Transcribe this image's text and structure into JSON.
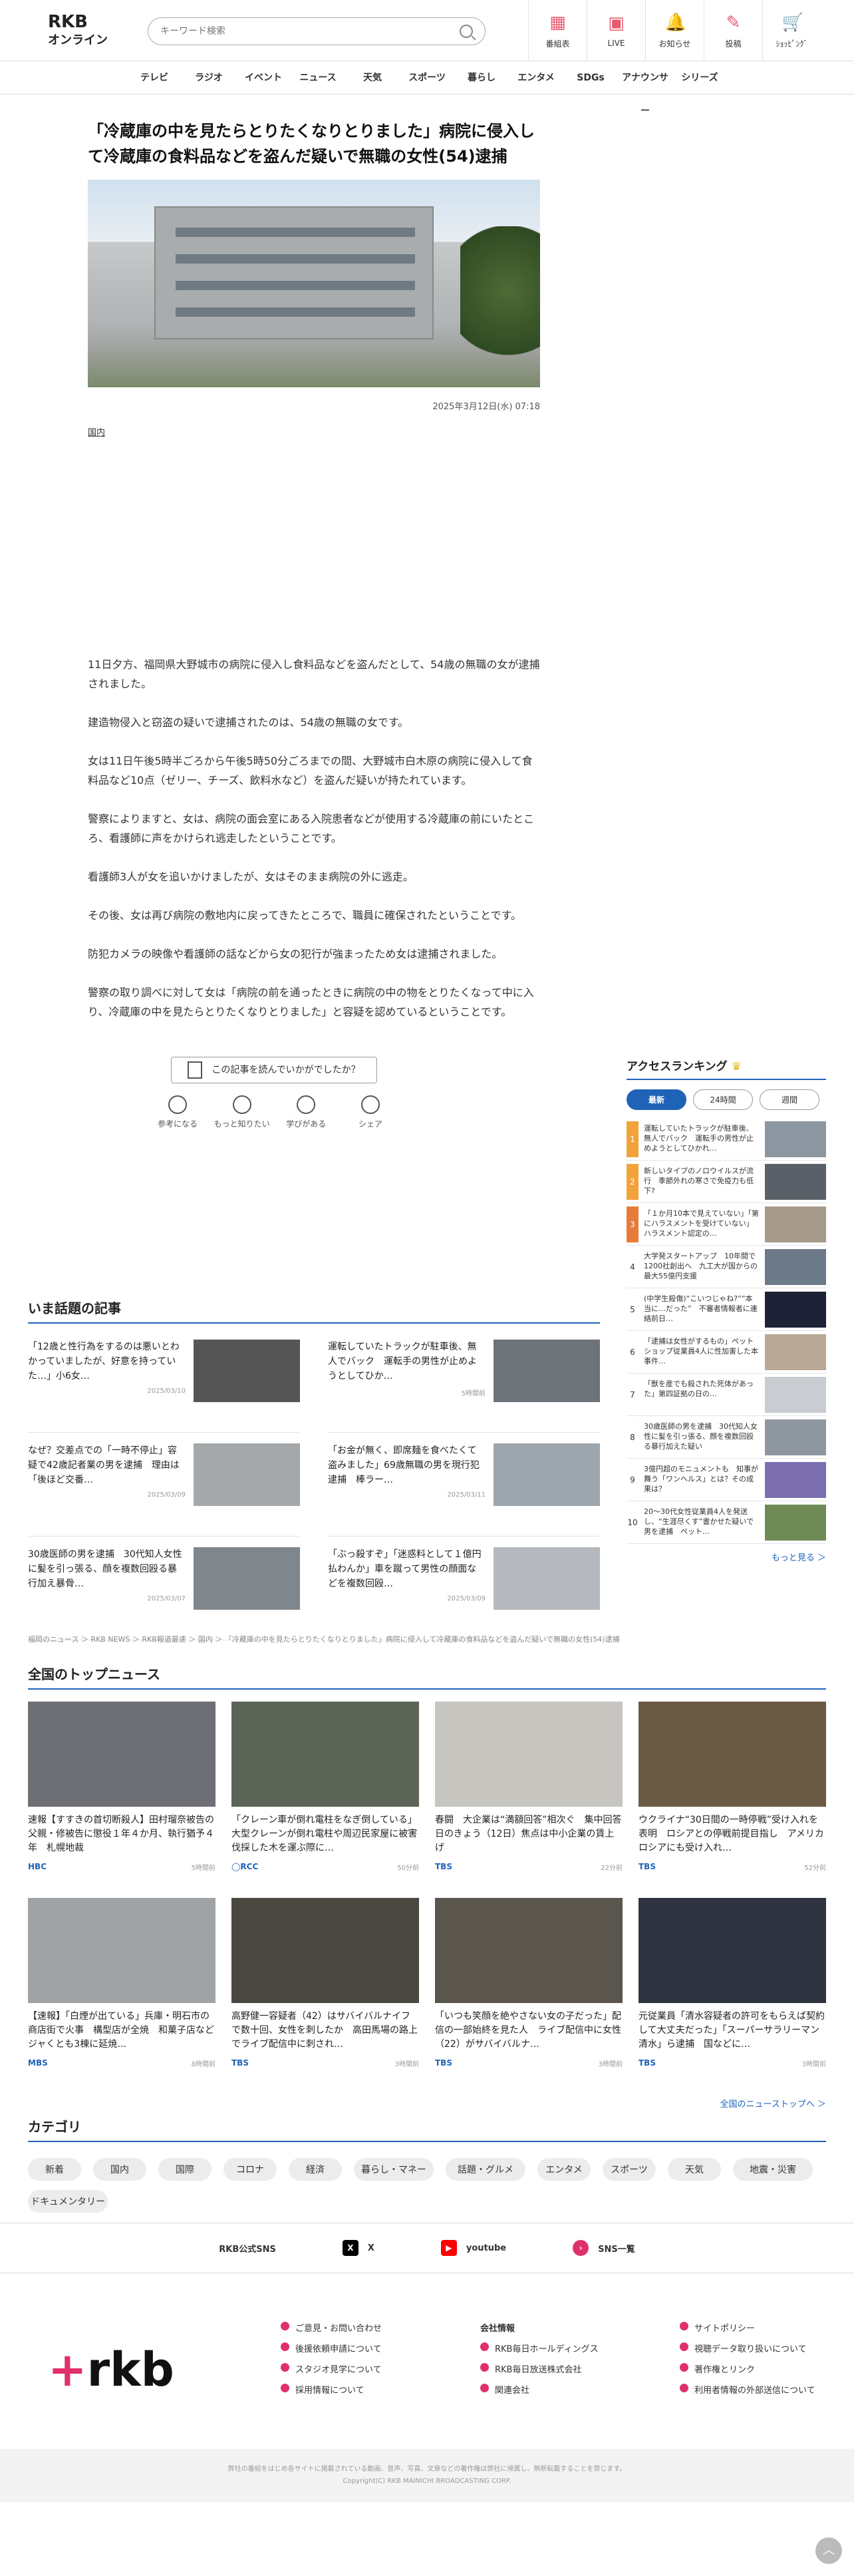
{
  "header": {
    "logo_line1": "RKB",
    "logo_line2": "オンライン",
    "search_placeholder": "キーワード検索",
    "icons": [
      {
        "label": "番組表",
        "icon": "calendar-icon"
      },
      {
        "label": "LIVE",
        "icon": "live-icon"
      },
      {
        "label": "お知らせ",
        "icon": "bell-icon"
      },
      {
        "label": "投稿",
        "icon": "pencil-icon"
      },
      {
        "label": "ｼｮｯﾋﾟﾝｸﾞ",
        "icon": "cart-icon"
      }
    ]
  },
  "nav": [
    "テレビ",
    "ラジオ",
    "イベント",
    "ニュース",
    "天気",
    "スポーツ",
    "暮らし",
    "エンタメ",
    "SDGs",
    "アナウンサー",
    "シリーズ"
  ],
  "article": {
    "title": "「冷蔵庫の中を見たらとりたくなりとりました」病院に侵入して冷蔵庫の食料品などを盗んだ疑いで無職の女性(54)逮捕",
    "date": "2025年3月12日(水) 07:18",
    "category": "国内",
    "paragraphs": [
      "11日夕方、福岡県大野城市の病院に侵入し食料品などを盗んだとして、54歳の無職の女が逮捕されました。",
      "建造物侵入と窃盗の疑いで逮捕されたのは、54歳の無職の女です。",
      "女は11日午後5時半ごろから午後5時50分ごろまでの間、大野城市白木原の病院に侵入して食料品など10点（ゼリー、チーズ、飲料水など）を盗んだ疑いが持たれています。",
      "警察によりますと、女は、病院の面会室にある入院患者などが使用する冷蔵庫の前にいたところ、看護師に声をかけられ逃走したということです。",
      "看護師3人が女を追いかけましたが、女はそのまま病院の外に逃走。",
      "その後、女は再び病院の敷地内に戻ってきたところで、職員に確保されたということです。",
      "防犯カメラの映像や看護師の話などから女の犯行が強まったため女は逮捕されました。",
      "警察の取り調べに対して女は「病院の前を通ったときに病院の中の物をとりたくなって中に入り、冷蔵庫の中を見たらとりたくなりとりました」と容疑を認めているということです。"
    ]
  },
  "reaction": {
    "question": "この記事を読んでいかがでしたか？",
    "buttons": [
      "参考になる",
      "もっと知りたい",
      "学びがある",
      "シェア"
    ]
  },
  "ranking": {
    "title": "アクセスランキング",
    "tabs": [
      "最新",
      "24時間",
      "週間"
    ],
    "items": [
      "運転していたトラックが駐車後、無人でバック　運転手の男性が止めようとしてひかれ…",
      "新しいタイプのノロウイルスが流行　季節外れの寒さで免疫力も低下?",
      "「１か月10本で見えていない」「第にハラスメントを受けていない」ハラスメント認定の…",
      "大学発スタートアップ　10年間で1200社創出へ　九工大が国からの最大55億円支援",
      "(中学生殺傷)“こいつじゃね?”“本当に…だった”　不審者情報者に連絡前日…",
      "「逮捕は女性がするもの」ペットショップ従業員4人に性加害した本事件…",
      "「獣を産でも殺された死体があった」第四証拠の日の…",
      "30歳医師の男を逮捕　30代知人女性に髪を引っ張る、顔を複数回殴る暴行加えた疑い",
      "3億円超のモニュメントも　知事が舞う「ワンヘルス」とは？その成果は？",
      "20～30代女性従業員4人を発送し、“生涯尽くす”書かせた疑いで男を逮捕　ペット…"
    ],
    "more": "もっと見る ＞"
  },
  "hot": {
    "title": "いま話題の記事",
    "items": [
      {
        "title": "「12歳と性行為をするのは悪いとわかっていましたが、好意を持っていた…」小6女…",
        "date": "2025/03/10"
      },
      {
        "title": "運転していたトラックが駐車後、無人でバック　運転手の男性が止めようとしてひか…",
        "date": "5時間前"
      },
      {
        "title": "なぜ？交差点での「一時不停止」容疑で42歳記者業の男を逮捕　理由は「後ほど交番…",
        "date": "2025/03/09"
      },
      {
        "title": "「お金が無く、即席麺を食べたくて盗みました」69歳無職の男を現行犯逮捕　棒ラー…",
        "date": "2025/03/11"
      },
      {
        "title": "30歳医師の男を逮捕　30代知人女性に髪を引っ張る、顔を複数回殴る暴行加え暴骨…",
        "date": "2025/03/07"
      },
      {
        "title": "「ぶっ殺すぞ」「迷惑料として１億円払わんか」車を蹴って男性の顔面などを複数回殴…",
        "date": "2025/03/09"
      }
    ]
  },
  "breadcrumb": "福岡のニュース ＞ RKB NEWS ＞ RKB報道最速 ＞ 国内 ＞ 「冷蔵庫の中を見たらとりたくなりとりました」病院に侵入して冷蔵庫の食料品などを盗んだ疑いで無職の女性(54)逮捕",
  "national": {
    "title": "全国のトップニュース",
    "items": [
      {
        "title": "速報【すすきの首切断殺人】田村瑠奈被告の父親・修被告に懲役１年４か月、執行猶予４年　札幌地裁",
        "src": "HBC",
        "ago": "5時間前",
        "color": "#6d6f74"
      },
      {
        "title": "「クレーン車が倒れ電柱をなぎ倒している」大型クレーンが倒れ電柱や周辺民家屋に被害　伐採した木を運ぶ際に…",
        "src": "◯RCC",
        "ago": "50分前",
        "color": "#5b6456"
      },
      {
        "title": "春闘　大企業は“満額回答”相次ぐ　集中回答日のきょう（12日）焦点は中小企業の賃上げ",
        "src": "TBS",
        "ago": "22分前",
        "color": "#c7c5c0"
      },
      {
        "title": "ウクライナ“30日間の一時停戦”受け入れを表明　ロシアとの停戦前提目指し　アメリカ　ロシアにも受け入れ…",
        "src": "TBS",
        "ago": "52分前",
        "color": "#6b5a44"
      },
      {
        "title": "【速報】「白煙が出ている」兵庫・明石市の商店街で火事　構型店が全焼　和菓子店などジャくとも3棟に延焼…",
        "src": "MBS",
        "ago": "8時間前",
        "color": "#9fa3a6"
      },
      {
        "title": "高野健一容疑者（42）はサバイバルナイフで数十回、女性を刺したか　高田馬場の路上でライブ配信中に刺され…",
        "src": "TBS",
        "ago": "3時間前",
        "color": "#4a4740"
      },
      {
        "title": "「いつも笑顔を絶やさない女の子だった」配信の一部始終を見た人　ライブ配信中に女性（22）がサバイバルナ…",
        "src": "TBS",
        "ago": "3時間前",
        "color": "#5a564d"
      },
      {
        "title": "元従業員「清水容疑者の許可をもらえば契約して大丈夫だった」「スーパーサラリーマン清水」ら逮捕　国などに…",
        "src": "TBS",
        "ago": "3時間前",
        "color": "#2f3440"
      }
    ],
    "more": "全国のニューストップへ ＞"
  },
  "categories": {
    "title": "カテゴリ",
    "items": [
      "新着",
      "国内",
      "国際",
      "コロナ",
      "経済",
      "暮らし・マネー",
      "話題・グルメ",
      "エンタメ",
      "スポーツ",
      "天気",
      "地震・災害",
      "ドキュメンタリー"
    ]
  },
  "sns": {
    "label": "RKB公式SNS",
    "items": [
      {
        "name": "X",
        "icon": "x-icon",
        "color": "#000000"
      },
      {
        "name": "youtube",
        "icon": "youtube-icon",
        "color": "#ff0000"
      },
      {
        "name": "SNS一覧",
        "icon": "sns-list-icon",
        "color": "#e0306a"
      }
    ]
  },
  "footer": {
    "logo": "rkb",
    "col1": [
      "ご意見・お問い合わせ",
      "後援依頼申請について",
      "スタジオ見学について",
      "採用情報について"
    ],
    "col2_title": "会社情報",
    "col2": [
      "RKB毎日ホールディングス",
      "RKB毎日放送株式会社",
      "関連会社"
    ],
    "col3": [
      "サイトポリシー",
      "視聴データ取り扱いについて",
      "著作権とリンク",
      "利用者情報の外部送信について"
    ],
    "copy1": "弊社の番組をはじめ各サイトに掲載されている動画、音声、写真、文章などの著作権は弊社に帰属し、無断転載することを禁じます。",
    "copy2": "Copyright(C) RKB MAINICHI BROADCASTING CORP."
  },
  "colors": {
    "accent": "#1f63b8",
    "brand": "#e0306a",
    "header_icon": "#e85a6c"
  }
}
